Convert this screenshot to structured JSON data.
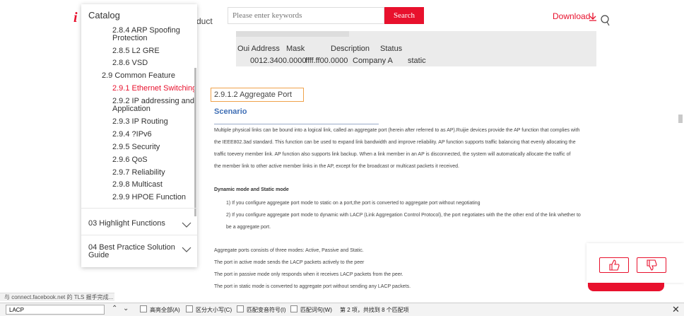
{
  "header": {
    "logo_fragment": "i",
    "partial_nav": "duct",
    "search_placeholder": "Please enter keywords",
    "search_button": "Search",
    "download": "Download"
  },
  "code_block": {
    "columns": [
      "Oui Address",
      "Mask",
      "Description",
      "Status"
    ],
    "row": [
      "0012.3400.0000",
      "ffff.ff00.0000",
      "Company A",
      "static"
    ]
  },
  "section": {
    "title": "2.9.1.2   Aggregate Port",
    "scenario": "Scenario",
    "paragraph": [
      "Multiple physical links can be bound into a logical link, called an aggregate port (herein after referred to as AP).Ruijie devices provide the AP function that complies with",
      "the IEEE802.3ad standard. This function can be used to expand link bandwidth and improve reliability. AP function supports traffic balancing that evenly allocating the",
      "traffic toevery member link. AP function also supports link backup. When a link member in an AP is disconnected, the system will automatically allocate the traffic of",
      "the member link to other active member links in the AP, except for the broadcast or multicast packets it received."
    ],
    "dynamic_heading": "Dynamic mode and Static mode",
    "item1": "1) If you configure aggregate port mode to static on a port,the port is converted to aggregate port without negotiating",
    "item2a": "2) If you configure aggregate port mode to dynamic with LACP (Link Aggregation Control Protocol), the port negotiates with the the other end of the link whether to",
    "item2b": "be a aggregate port.",
    "modes": "Aggregate ports consists of three modes:  Active, Passive and Static.",
    "active": "The port in active mode sends the LACP packets actively to the peer",
    "passive": "The port in passive mode only responds when it receives LACP packets from the peer.",
    "static": "The port in static mode is converted to aggregate port without sending any LACP packets."
  },
  "catalog": {
    "title": "Catalog",
    "items": [
      "2.8.4 ARP Spoofing",
      "Protection",
      "2.8.5 L2 GRE",
      "2.8.6 VSD",
      "2.9 Common Feature",
      "2.9.1 Ethernet Switching",
      "2.9.2 IP addressing and",
      "Application",
      "2.9.3 IP Routing",
      "2.9.4 ?IPv6",
      "2.9.5 Security",
      "2.9.6 QoS",
      "2.9.7 Reliability",
      "2.9.8 Multicast",
      "2.9.9 HPOE Function"
    ],
    "sections": [
      "03 Highlight Functions",
      "04 Best Practice Solution",
      "Guide"
    ]
  },
  "status_text": "与 connect.facebook.net 的 TLS 握手完成...",
  "findbar": {
    "query": "LACP",
    "highlight_all": "高亮全部(A)",
    "match_case": "区分大小写(C)",
    "match_diacritics": "匹配变音符号(I)",
    "whole_words": "匹配词句(W)",
    "result": "第 2 项，共找到 8 个匹配项"
  },
  "colors": {
    "brand": "#e8112d",
    "accent_blue": "#3f6fb5",
    "highlight_border": "#f0a24b"
  }
}
